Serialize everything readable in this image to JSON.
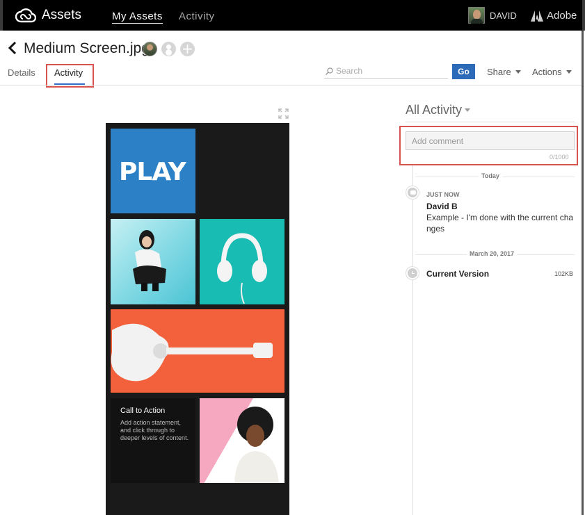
{
  "topbar": {
    "brand": "Assets",
    "nav": [
      "My Assets",
      "Activity"
    ],
    "user_name": "DAVID",
    "adobe": "Adobe"
  },
  "header": {
    "file_title": "Medium Screen.jpg",
    "tabs": [
      "Details",
      "Activity"
    ],
    "active_tab": "Activity",
    "search_placeholder": "Search",
    "go_label": "Go",
    "share_label": "Share",
    "actions_label": "Actions"
  },
  "preview": {
    "play_text": "PLAY",
    "cta_title": "Call to Action",
    "cta_body": "Add action statement, and click through to deeper levels of content."
  },
  "activity": {
    "filter_label": "All Activity",
    "comment_placeholder": "Add comment",
    "char_count": "0/1000",
    "groups": [
      {
        "date": "Today",
        "event": {
          "time": "JUST NOW",
          "author": "David B",
          "text": "Example - I'm done with the current changes"
        }
      },
      {
        "date": "March 20, 2017",
        "event": {
          "label": "Current Version",
          "size": "102KB"
        }
      }
    ]
  },
  "colors": {
    "topbar_bg": "#000000",
    "accent_blue": "#2d6ab8",
    "highlight_red": "#d9534f",
    "play_tile": "#2b80c6",
    "headphones_tile": "#19bcb2",
    "guitar_tile": "#f2603c"
  }
}
